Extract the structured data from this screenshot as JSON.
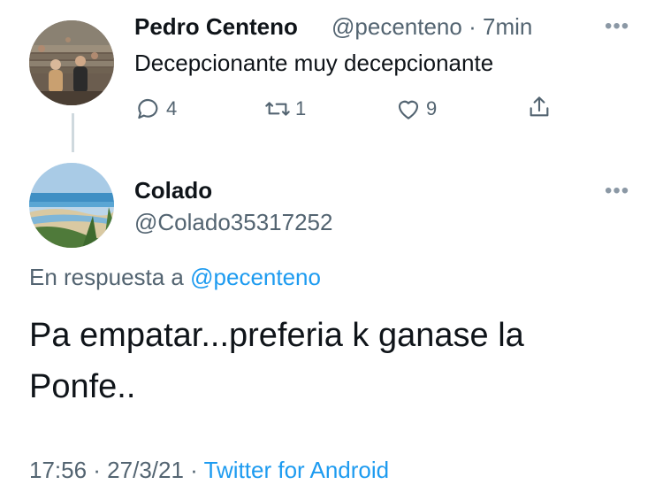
{
  "parent_tweet": {
    "name": "Pedro Centeno",
    "handle": "@pecenteno",
    "separator": "·",
    "time": "7min",
    "text": "Decepcionante muy decepcionante",
    "replies": "4",
    "retweets": "1",
    "likes": "9",
    "avatar_icon": "crowd-photo-avatar"
  },
  "reply_tweet": {
    "name": "Colado",
    "handle": "@Colado35317252",
    "replying_prefix": "En respuesta a",
    "replying_to": "@pecenteno",
    "text": "Pa empatar...preferia k ganase la Ponfe..",
    "timestamp": "17:56 · 27/3/21 ·",
    "source": "Twitter for Android",
    "avatar_icon": "beach-photo-avatar"
  },
  "icons": {
    "more": "more-horizontal-icon",
    "reply": "comment-icon",
    "retweet": "retweet-icon",
    "like": "heart-icon",
    "share": "share-icon"
  },
  "colors": {
    "link": "#1d9bf0",
    "secondary_text": "#536471",
    "thread_line": "#cfd9de"
  }
}
